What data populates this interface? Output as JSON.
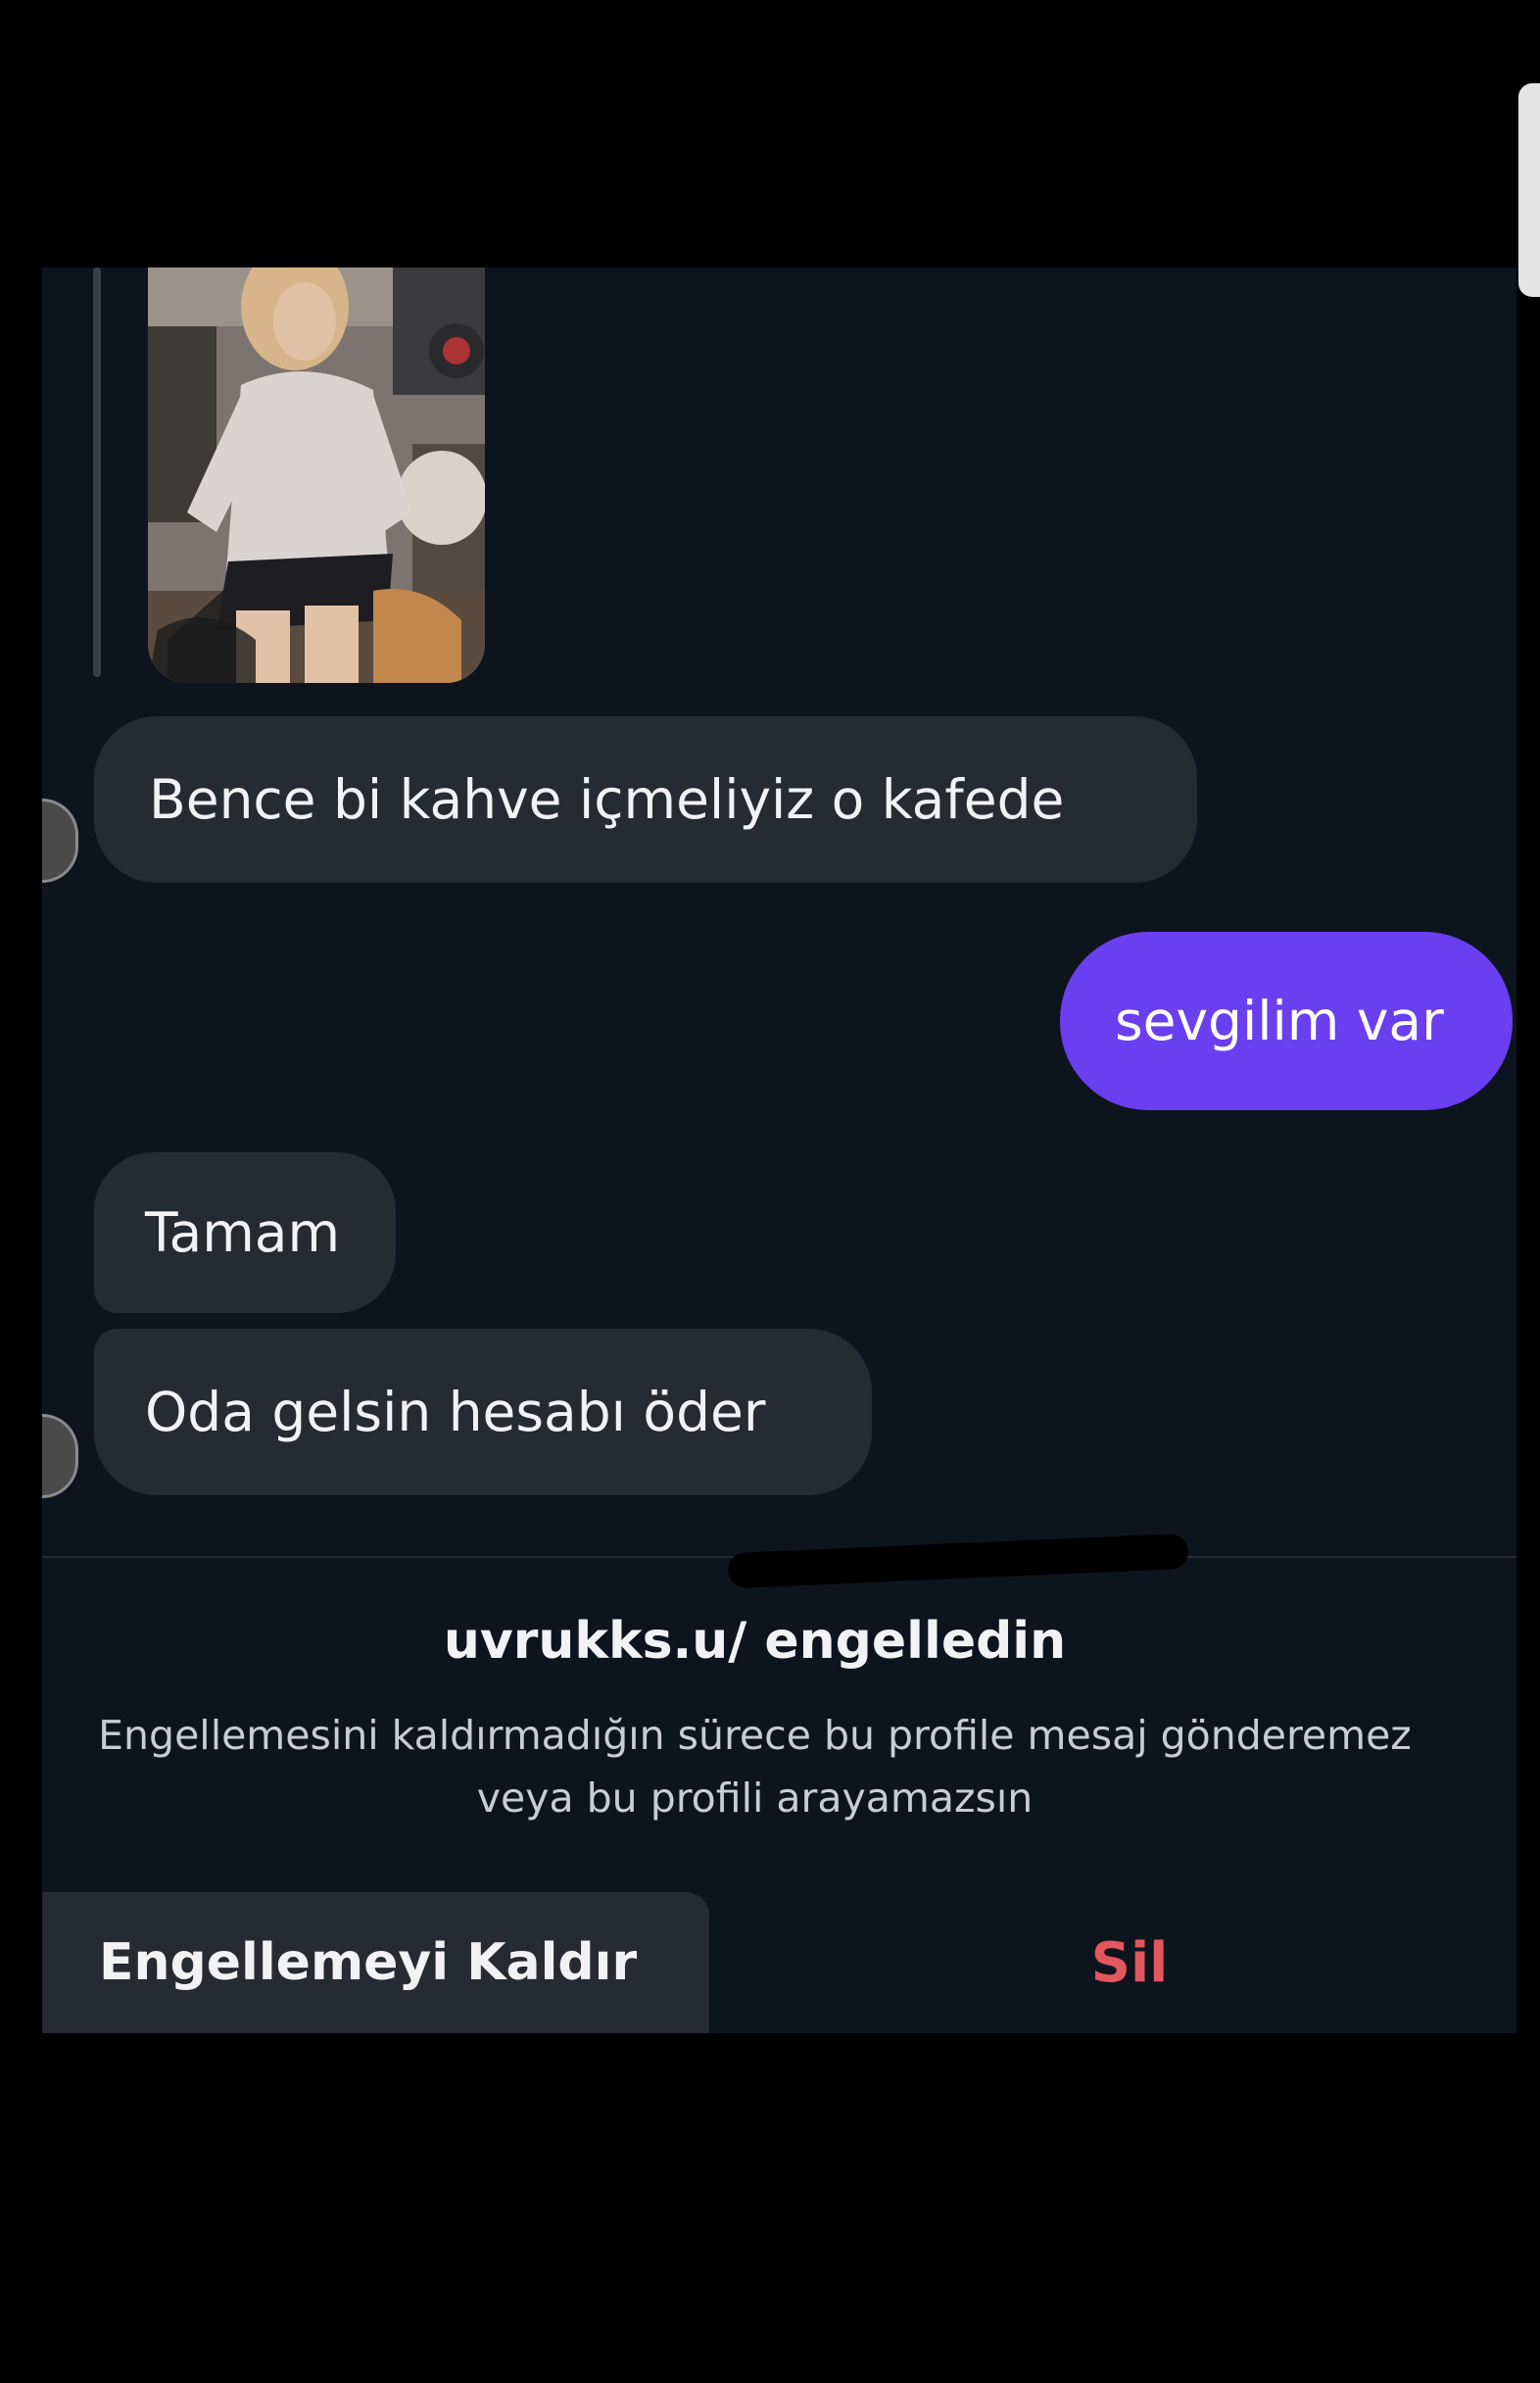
{
  "colors": {
    "background": "#000000",
    "chat_background": "#0e141d",
    "incoming_bubble": "#262a31",
    "outgoing_bubble": "#6a3ff0",
    "delete_text": "#e2565d"
  },
  "shared_photo": {
    "icon": "photo-of-woman-in-cafe"
  },
  "messages": [
    {
      "direction": "incoming",
      "text": "Bence bi kahve içmeliyiz o kafede"
    },
    {
      "direction": "outgoing",
      "text": "sevgilim var"
    },
    {
      "direction": "incoming",
      "text": "Tamam"
    },
    {
      "direction": "incoming",
      "text": "Oda gelsin hesabı öder"
    }
  ],
  "block_notice": {
    "title": "uvrukks.u/ engelledin",
    "description": "Engellemesini kaldırmadığın sürece bu profile mesaj gönderemez\nveya bu profili arayamazsın"
  },
  "actions": {
    "unblock_label": "Engellemeyi Kaldır",
    "delete_label": "Sil"
  }
}
